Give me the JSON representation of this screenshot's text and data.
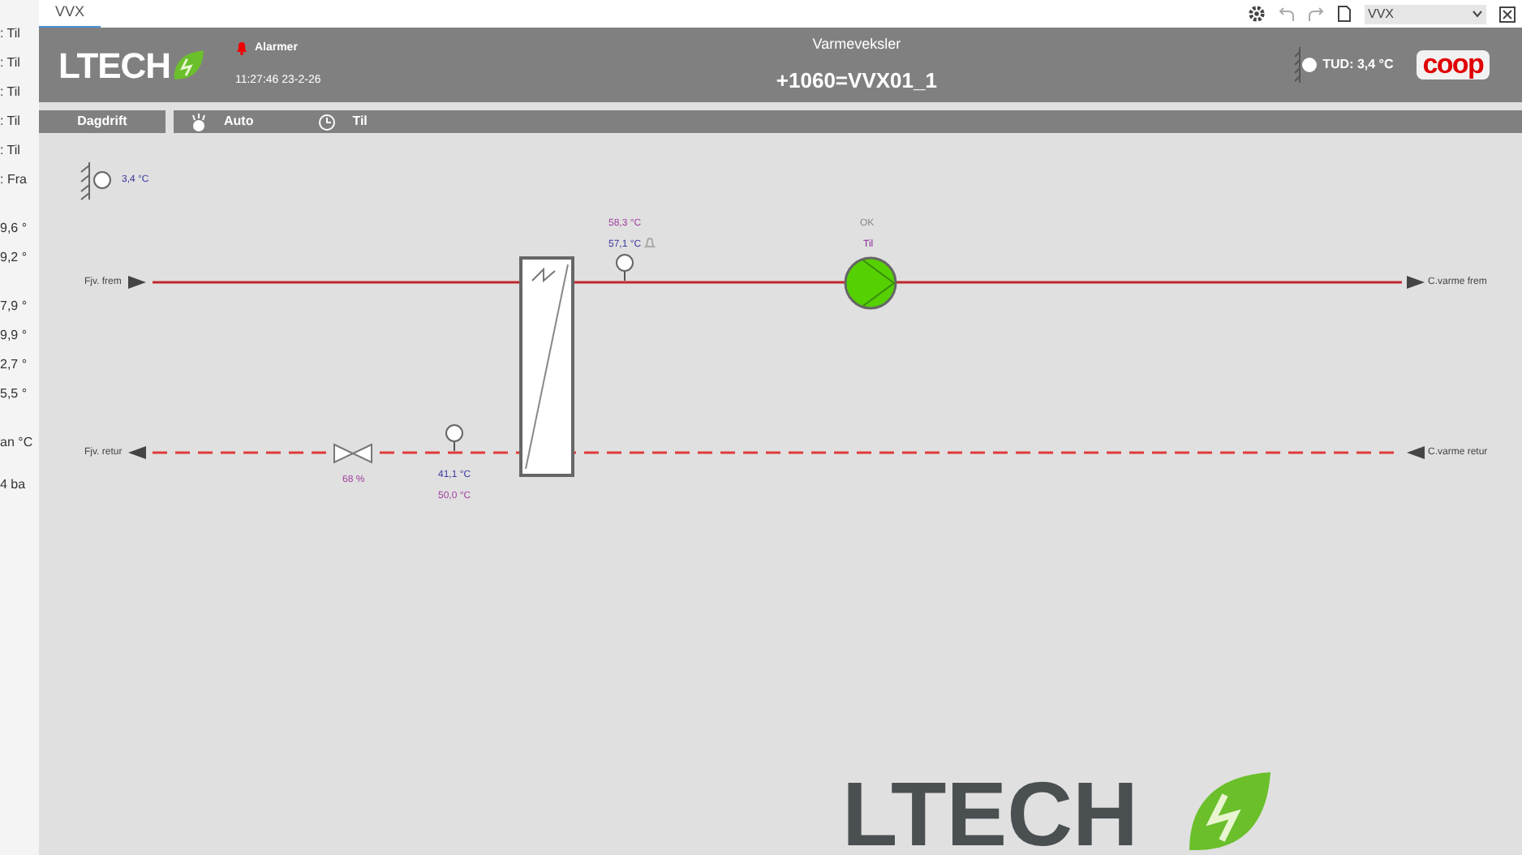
{
  "left_panel_fragments": [
    ": Til",
    ": Til",
    ": Til",
    ": Til",
    ": Til",
    ": Fra",
    "9,6 °",
    "9,2 °",
    "7,9 °",
    "9,9 °",
    "2,7 °",
    "5,5 °",
    "an °C",
    "4 ba"
  ],
  "tab": {
    "label": "VVX",
    "selected": true
  },
  "toolbar": {
    "select_value": "VVX"
  },
  "header": {
    "logo": "LTECH",
    "alarm_label": "Alarmer",
    "timestamp": "11:27:46 23-2-26",
    "subtitle": "Varmeveksler",
    "title": "+1060=VVX01_1",
    "outdoor_reading": "TUD: 3,4 °C",
    "brand": "coop"
  },
  "mode_bar": {
    "mode_button": "Dagdrift",
    "auto_label": "Auto",
    "state_label": "Til"
  },
  "diagram": {
    "outdoor_temp": "3,4 °C",
    "supply_in_label": "Fjv. frem",
    "return_out_label": "Fjv. retur",
    "supply_out_label": "C.varme frem",
    "return_in_label": "C.varme retur",
    "supply_setpoint": "58,3 °C",
    "supply_temp": "57,1 °C",
    "pump_status": "OK",
    "pump_state": "Til",
    "pump_on": true,
    "valve_opening": "68 %",
    "return_temp": "41,1 °C",
    "return_setpoint": "50,0 °C"
  },
  "background_logo": "LTECH"
}
